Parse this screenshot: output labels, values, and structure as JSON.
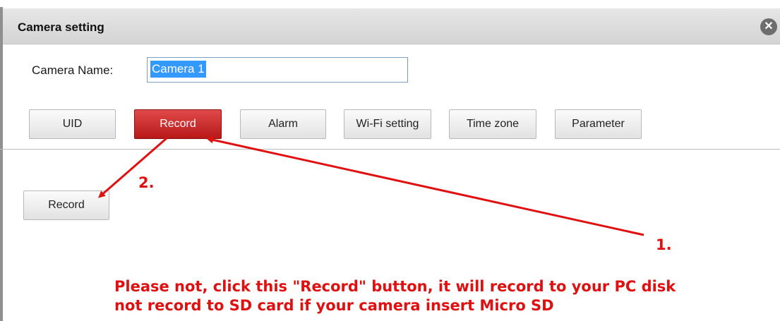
{
  "window": {
    "title": "Camera setting",
    "close_icon": "close-icon"
  },
  "camera_name": {
    "label": "Camera Name:",
    "value": "Camera 1"
  },
  "tabs": [
    {
      "label": "UID",
      "active": false
    },
    {
      "label": "Record",
      "active": true
    },
    {
      "label": "Alarm",
      "active": false
    },
    {
      "label": "Wi-Fi setting",
      "active": false
    },
    {
      "label": "Time zone",
      "active": false
    },
    {
      "label": "Parameter",
      "active": false
    }
  ],
  "record_panel": {
    "record_button_label": "Record"
  },
  "annotation": {
    "marker_1": "1.",
    "marker_2": "2.",
    "note_line_1": "Please not, click this \"Record\" button, it will record to your PC disk",
    "note_line_2": "not record  to SD card if your camera insert Micro SD",
    "color": "#e01010"
  },
  "colors": {
    "active_tab": "#c82020",
    "selection": "#3399ff"
  }
}
